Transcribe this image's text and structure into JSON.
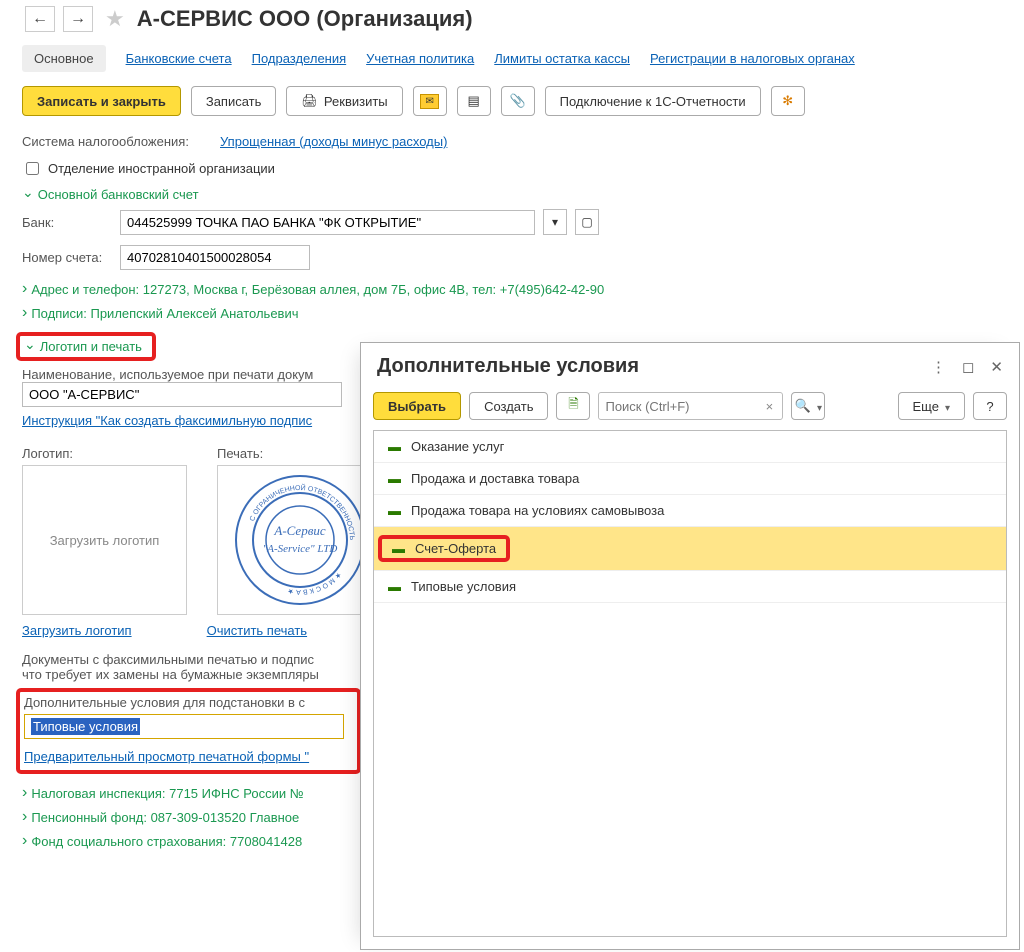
{
  "header": {
    "title": "А-СЕРВИС ООО (Организация)"
  },
  "tabs": {
    "main": "Основное",
    "bank_accounts": "Банковские счета",
    "divisions": "Подразделения",
    "acc_policy": "Учетная политика",
    "cash_limits": "Лимиты остатка кассы",
    "tax_reg": "Регистрации в налоговых органах"
  },
  "toolbar": {
    "save_close": "Записать и закрыть",
    "save": "Записать",
    "requisites": "Реквизиты",
    "connect_1c": "Подключение к 1С-Отчетности"
  },
  "tax_system": {
    "label": "Система налогообложения:",
    "value": "Упрощенная (доходы минус расходы)"
  },
  "foreign_org_checkbox": "Отделение иностранной организации",
  "sections": {
    "bank_account": "Основной банковский счет",
    "address": "Адрес и телефон: 127273, Москва г, Берёзовая аллея, дом 7Б, офис 4В, тел: +7(495)642-42-90",
    "signatures": "Подписи: Прилепский Алексей Анатольевич",
    "logo_stamp": "Логотип и печать",
    "tax_inspection": "Налоговая инспекция: 7715 ИФНС России №",
    "pension_fund": "Пенсионный фонд: 087-309-013520 Главное",
    "social_insurance": "Фонд социального страхования: 7708041428"
  },
  "bank": {
    "label": "Банк:",
    "value": "044525999 ТОЧКА ПАО БАНКА \"ФК ОТКРЫТИЕ\""
  },
  "account": {
    "label": "Номер счета:",
    "value": "40702810401500028054"
  },
  "print_name": {
    "label": "Наименование, используемое при печати докум",
    "value": "ООО \"А-СЕРВИС\""
  },
  "instruction_link": "Инструкция \"Как создать факсимильную подпис",
  "logo": {
    "label": "Логотип:",
    "placeholder": "Загрузить логотип",
    "upload_link": "Загрузить логотип"
  },
  "stamp": {
    "label": "Печать:",
    "clear_link": "Очистить печать"
  },
  "fax_docs_note": "Документы с факсимильными печатью и подпис\nчто требует их замены на бумажные экземпляры",
  "extra_conditions": {
    "label": "Дополнительные условия для подстановки в с",
    "value": "Типовые условия"
  },
  "preview_link": "Предварительный просмотр печатной формы \"",
  "dialog": {
    "title": "Дополнительные условия",
    "select": "Выбрать",
    "create": "Создать",
    "search_placeholder": "Поиск (Ctrl+F)",
    "more": "Еще",
    "help": "?",
    "items": [
      "Оказание услуг",
      "Продажа и доставка товара",
      "Продажа товара на условиях самовывоза",
      "Счет-Оферта",
      "Типовые условия"
    ]
  }
}
